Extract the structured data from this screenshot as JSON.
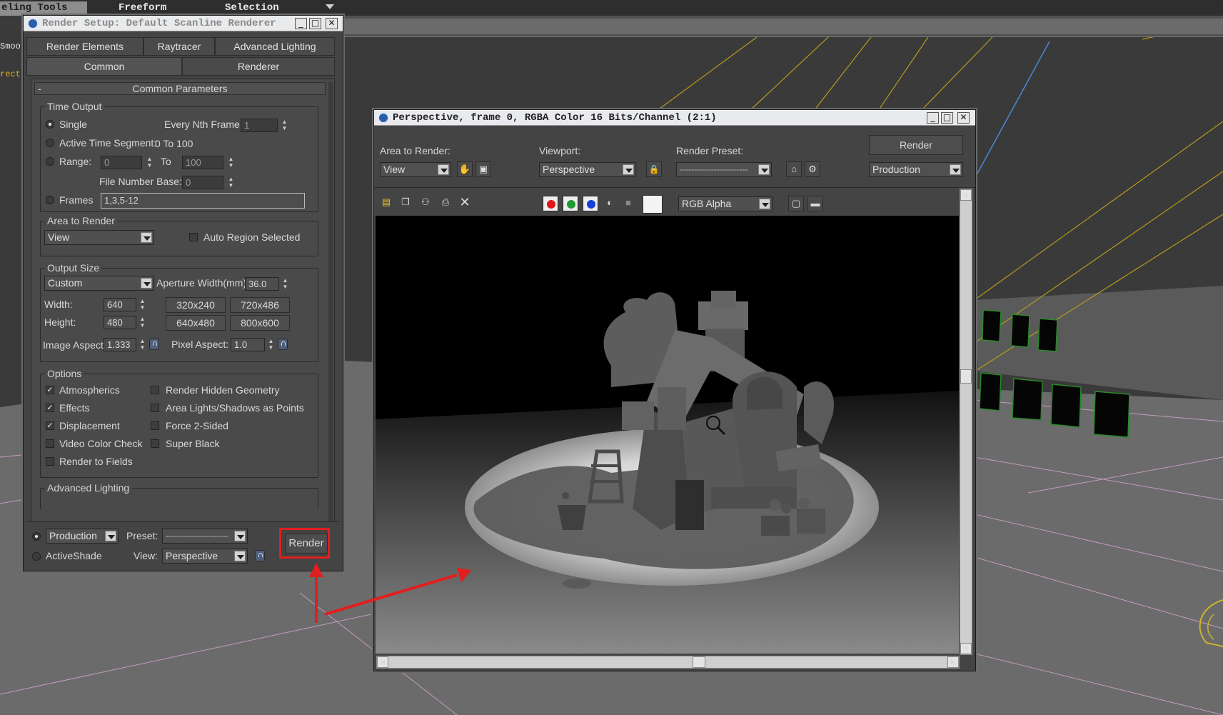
{
  "ribbon": {
    "tabs": [
      "eling Tools",
      "Freeform",
      "Selection"
    ],
    "viewport_side": [
      "Smoo",
      "rect"
    ]
  },
  "render_setup": {
    "title": "Render Setup: Default Scanline Renderer",
    "tabs_row1": [
      "Render Elements",
      "Raytracer",
      "Advanced Lighting"
    ],
    "tabs_row2": [
      "Common",
      "Renderer"
    ],
    "rollout_title": "Common Parameters",
    "rollout_toggle": "-",
    "time_output": {
      "label": "Time Output",
      "single": "Single",
      "every_nth_label": "Every Nth Frame:",
      "every_nth_value": "1",
      "active_segment": "Active Time Segment:",
      "active_segment_value": "0 To 100",
      "range_label": "Range:",
      "range_from": "0",
      "range_to_label": "To",
      "range_to": "100",
      "file_number_base_label": "File Number Base:",
      "file_number_base": "0",
      "frames_label": "Frames",
      "frames_value": "1,3,5-12"
    },
    "area_to_render": {
      "label": "Area to Render",
      "value": "View",
      "auto_region": "Auto Region Selected"
    },
    "output_size": {
      "label": "Output Size",
      "preset": "Custom",
      "aperture_label": "Aperture Width(mm):",
      "aperture_value": "36.0",
      "width_label": "Width:",
      "width_value": "640",
      "height_label": "Height:",
      "height_value": "480",
      "presets": [
        "320x240",
        "720x486",
        "640x480",
        "800x600"
      ],
      "image_aspect_label": "Image Aspect:",
      "image_aspect_value": "1.333",
      "pixel_aspect_label": "Pixel Aspect:",
      "pixel_aspect_value": "1.0"
    },
    "options": {
      "label": "Options",
      "left": [
        {
          "label": "Atmospherics",
          "checked": true
        },
        {
          "label": "Effects",
          "checked": true
        },
        {
          "label": "Displacement",
          "checked": true
        },
        {
          "label": "Video Color Check",
          "checked": false
        },
        {
          "label": "Render to Fields",
          "checked": false
        }
      ],
      "right": [
        {
          "label": "Render Hidden Geometry",
          "checked": false
        },
        {
          "label": "Area Lights/Shadows as Points",
          "checked": false
        },
        {
          "label": "Force 2-Sided",
          "checked": false
        },
        {
          "label": "Super Black",
          "checked": false
        }
      ]
    },
    "advanced_lighting_label": "Advanced Lighting",
    "footer": {
      "production": "Production",
      "preset_label": "Preset:",
      "preset_value": "----------------------",
      "activeshade": "ActiveShade",
      "view_label": "View:",
      "view_value": "Perspective",
      "render_button": "Render"
    }
  },
  "frame_window": {
    "title": "Perspective, frame 0, RGBA Color 16 Bits/Channel (2:1)",
    "area_to_render_label": "Area to Render:",
    "area_to_render_value": "View",
    "viewport_label": "Viewport:",
    "viewport_value": "Perspective",
    "render_preset_label": "Render Preset:",
    "render_preset_value": "------------------------",
    "render_button": "Render",
    "production_value": "Production",
    "channel_value": "RGB Alpha"
  },
  "colors": {
    "highlight": "#e21e1e",
    "channel_red": "#e0161b",
    "channel_green": "#1f9a2e",
    "channel_blue": "#1640d8"
  }
}
